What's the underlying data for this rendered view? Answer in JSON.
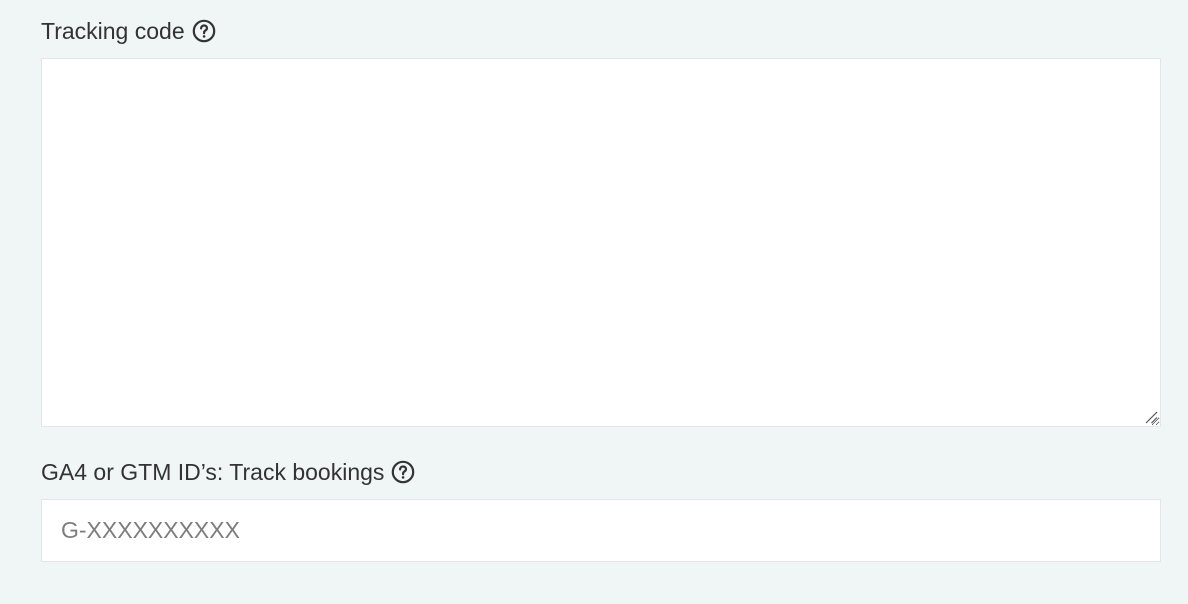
{
  "tracking_code": {
    "label": "Tracking code",
    "help_icon": "question-circle-icon",
    "value": ""
  },
  "ga4_gtm": {
    "label": "GA4 or GTM ID’s: Track bookings",
    "help_icon": "question-circle-icon",
    "value": "",
    "placeholder": "G-XXXXXXXXXX"
  },
  "colors": {
    "background": "#f0f5f5",
    "field_background": "#ffffff",
    "field_border": "#e2e6e6",
    "text": "#333333",
    "placeholder": "#7d7d7d"
  }
}
